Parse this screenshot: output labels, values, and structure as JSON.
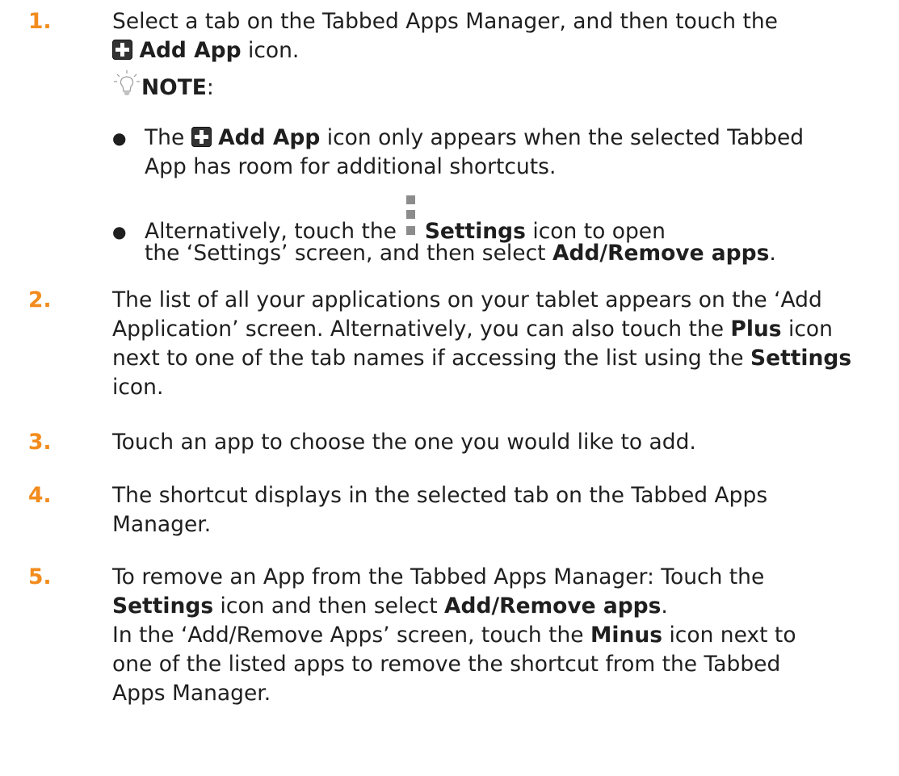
{
  "steps": {
    "s1": {
      "num": "1.",
      "l1": "Select a tab on the Tabbed Apps Manager, and then touch the",
      "l2_bold": "Add App",
      "l2_rest": " icon."
    },
    "note": {
      "label": "NOTE",
      "colon": ":",
      "b1_pre": "The",
      "b1_bold": "Add App",
      "b1_rest": " icon only appears when the selected Tabbed",
      "b1_l2": "App has room for additional shortcuts.",
      "b2_pre": "Alternatively, touch the ",
      "b2_bold": "Settings",
      "b2_rest": " icon to open",
      "b2_l2_pre": "the ‘Settings’ screen, and then select ",
      "b2_l2_bold": "Add/Remove apps",
      "b2_l2_end": "."
    },
    "s2": {
      "num": "2.",
      "l1": "The list of all your applications on your tablet appears on the ‘Add",
      "l2_pre": "Application’ screen.  Alternatively, you can also touch the ",
      "l2_bold": "Plus",
      "l2_rest": " icon",
      "l3_pre": "next to one of the tab names if accessing the list using the ",
      "l3_bold": "Settings",
      "l4": "icon."
    },
    "s3": {
      "num": "3.",
      "l1": "Touch an app to choose the one you would like to add."
    },
    "s4": {
      "num": "4.",
      "l1": "The shortcut displays in the selected tab on the Tabbed Apps",
      "l2": "Manager."
    },
    "s5": {
      "num": "5.",
      "l1": "To remove an App from the Tabbed Apps Manager: Touch the",
      "l2_bold1": "Settings",
      "l2_mid": " icon and then select ",
      "l2_bold2": "Add/Remove apps",
      "l2_end": ".",
      "l3_pre": "In the ‘Add/Remove Apps’ screen, touch the ",
      "l3_bold": "Minus",
      "l3_rest": " icon next to",
      "l4": "one of the listed apps to remove the shortcut from the Tabbed",
      "l5": "Apps Manager."
    }
  },
  "icons": {
    "add_app": "plus-square-icon",
    "settings": "settings-dots-icon",
    "note": "lightbulb-icon",
    "bullet": "bullet-dot"
  },
  "colors": {
    "step_number": "#f28c1e",
    "text": "#1f1f1f",
    "settings_icon": "#8c8c8c"
  }
}
